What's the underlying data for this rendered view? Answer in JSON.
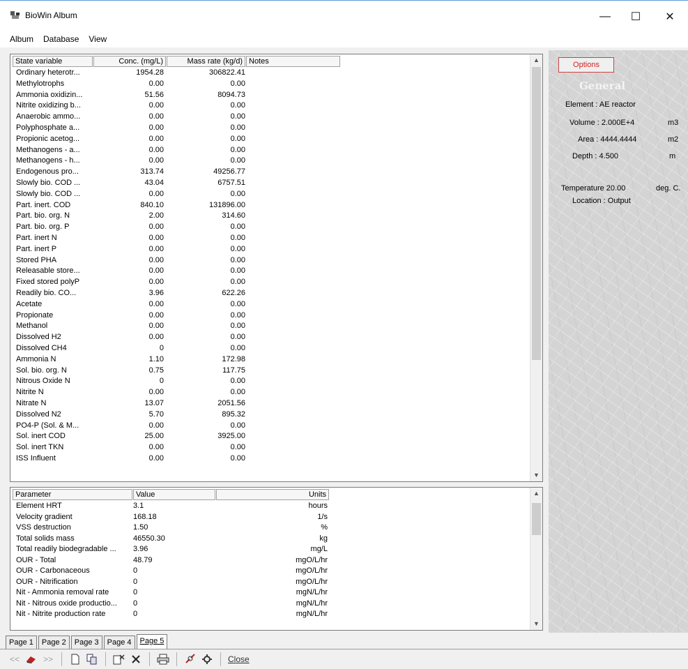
{
  "window": {
    "title": "BioWin Album",
    "min": "—",
    "max": "☐",
    "close": "✕"
  },
  "menu": [
    "Album",
    "Database",
    "View"
  ],
  "state_table": {
    "headers": [
      "State variable",
      "Conc. (mg/L)",
      "Mass rate (kg/d)",
      "Notes"
    ],
    "rows": [
      [
        "Ordinary heterotr...",
        "1954.28",
        "306822.41"
      ],
      [
        "Methylotrophs",
        "0.00",
        "0.00"
      ],
      [
        "Ammonia oxidizin...",
        "51.56",
        "8094.73"
      ],
      [
        "Nitrite oxidizing b...",
        "0.00",
        "0.00"
      ],
      [
        "Anaerobic ammo...",
        "0.00",
        "0.00"
      ],
      [
        "Polyphosphate a...",
        "0.00",
        "0.00"
      ],
      [
        "Propionic acetog...",
        "0.00",
        "0.00"
      ],
      [
        "Methanogens - a...",
        "0.00",
        "0.00"
      ],
      [
        "Methanogens - h...",
        "0.00",
        "0.00"
      ],
      [
        "Endogenous pro...",
        "313.74",
        "49256.77"
      ],
      [
        "Slowly bio. COD ...",
        "43.04",
        "6757.51"
      ],
      [
        "Slowly bio. COD ...",
        "0.00",
        "0.00"
      ],
      [
        "Part. inert. COD",
        "840.10",
        "131896.00"
      ],
      [
        "Part. bio. org. N",
        "2.00",
        "314.60"
      ],
      [
        "Part. bio. org. P",
        "0.00",
        "0.00"
      ],
      [
        "Part. inert N",
        "0.00",
        "0.00"
      ],
      [
        "Part. inert P",
        "0.00",
        "0.00"
      ],
      [
        "Stored PHA",
        "0.00",
        "0.00"
      ],
      [
        "Releasable store...",
        "0.00",
        "0.00"
      ],
      [
        "Fixed stored polyP",
        "0.00",
        "0.00"
      ],
      [
        "Readily bio. CO...",
        "3.96",
        "622.26"
      ],
      [
        "Acetate",
        "0.00",
        "0.00"
      ],
      [
        "Propionate",
        "0.00",
        "0.00"
      ],
      [
        "Methanol",
        "0.00",
        "0.00"
      ],
      [
        "Dissolved H2",
        "0.00",
        "0.00"
      ],
      [
        "Dissolved CH4",
        "0",
        "0.00"
      ],
      [
        "Ammonia N",
        "1.10",
        "172.98"
      ],
      [
        "Sol. bio. org. N",
        "0.75",
        "117.75"
      ],
      [
        "Nitrous Oxide N",
        "0",
        "0.00"
      ],
      [
        "Nitrite N",
        "0.00",
        "0.00"
      ],
      [
        "Nitrate N",
        "13.07",
        "2051.56"
      ],
      [
        "Dissolved N2",
        "5.70",
        "895.32"
      ],
      [
        "PO4-P (Sol. & M...",
        "0.00",
        "0.00"
      ],
      [
        "Sol. inert COD",
        "25.00",
        "3925.00"
      ],
      [
        "Sol. inert TKN",
        "0.00",
        "0.00"
      ],
      [
        "ISS Influent",
        "0.00",
        "0.00"
      ]
    ]
  },
  "param_table": {
    "headers": [
      "Parameter",
      "Value",
      "Units"
    ],
    "rows": [
      [
        "Element HRT",
        "3.1",
        "hours"
      ],
      [
        "Velocity gradient",
        "168.18",
        "1/s"
      ],
      [
        "VSS destruction",
        "1.50",
        "%"
      ],
      [
        "Total solids mass",
        "46550.30",
        "kg"
      ],
      [
        "Total readily biodegradable ...",
        "3.96",
        "mg/L"
      ],
      [
        "OUR - Total",
        "48.79",
        "mgO/L/hr"
      ],
      [
        "OUR - Carbonaceous",
        "0",
        "mgO/L/hr"
      ],
      [
        "OUR - Nitrification",
        "0",
        "mgO/L/hr"
      ],
      [
        "Nit - Ammonia removal rate",
        "0",
        "mgN/L/hr"
      ],
      [
        "Nit - Nitrous oxide productio...",
        "0",
        "mgN/L/hr"
      ],
      [
        "Nit - Nitrite production rate",
        "0",
        "mgN/L/hr"
      ]
    ]
  },
  "side": {
    "options": "Options",
    "general": "General",
    "element": "Element : AE reactor",
    "volume_label": "Volume : 2.000E+4",
    "volume_unit": "m3",
    "area_label": "Area : 4444.4444",
    "area_unit": "m2",
    "depth_label": "Depth : 4.500",
    "depth_unit": "m",
    "temp_label": "Temperature 20.00",
    "temp_unit": "deg. C.",
    "location": "Location : Output"
  },
  "tabs": [
    "Page 1",
    "Page 2",
    "Page 3",
    "Page 4",
    "Page 5"
  ],
  "toolbar": {
    "prev": "<<",
    "next": ">>",
    "close": "Close"
  }
}
